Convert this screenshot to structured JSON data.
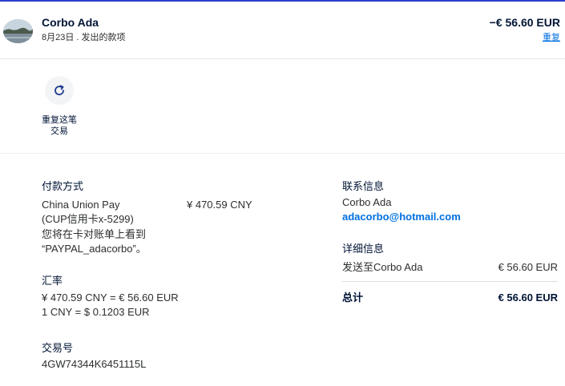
{
  "header": {
    "name": "Corbo Ada",
    "subtitle": "8月23日 . 发出的款项",
    "amount": "−€ 56.60 EUR",
    "repeat_link": "重复"
  },
  "actions": {
    "repeat_label_line1": "重复这笔",
    "repeat_label_line2": "交易",
    "repeat_icon": "refresh-icon"
  },
  "payment": {
    "heading": "付款方式",
    "method_line1": "China Union Pay",
    "method_line2": "(CUP信用卡x-5299)",
    "statement_line1": "您将在卡对账单上看到",
    "statement_line2": "“PAYPAL_adacorbo”。",
    "amount_cny": "¥ 470.59 CNY"
  },
  "exchange": {
    "heading": "汇率",
    "line1": "¥ 470.59 CNY = € 56.60 EUR",
    "line2": "1 CNY = $ 0.1203 EUR"
  },
  "transaction": {
    "heading": "交易号",
    "id": "4GW74344K6451115L"
  },
  "contact": {
    "heading": "联系信息",
    "name": "Corbo Ada",
    "email": "adacorbo@hotmail.com"
  },
  "details": {
    "heading": "详细信息",
    "ship_to_label": "发送至Corbo Ada",
    "ship_to_amount": "€ 56.60 EUR",
    "total_label": "总计",
    "total_amount": "€ 56.60 EUR"
  },
  "colors": {
    "accent": "#0070e0",
    "text": "#001435",
    "top_border": "#2a3fcf"
  }
}
